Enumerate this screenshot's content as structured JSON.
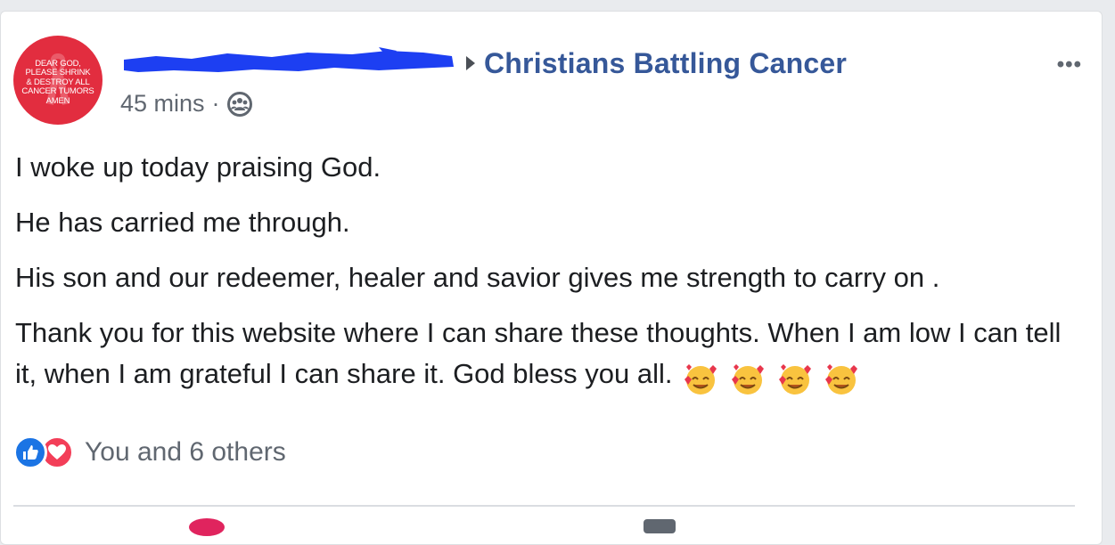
{
  "post": {
    "avatar_text": "DEAR GOD,\nPLEASE SHRINK\n& DESTROY ALL\nCANCER TUMORS\nAMEN",
    "group_name": "Christians Battling Cancer",
    "timestamp": "45 mins",
    "separator": "·",
    "audience_icon": "group-members-icon",
    "more_label": "•••",
    "body": {
      "line1": "I woke up today praising God.",
      "line2": "He has carried me through.",
      "line3": "His son and our redeemer, healer and savior gives me strength to carry on .",
      "line4": "Thank you for this website where I can share these thoughts. When I am low I can tell it, when I am grateful I can share it. God bless you all."
    },
    "emoji_name": "smiling-face-with-hearts",
    "reactions": {
      "text": "You and 6 others",
      "like_color": "#1b74e4",
      "love_color": "#f33e58"
    }
  },
  "colors": {
    "link": "#365899",
    "secondary": "#606770",
    "redaction": "#1d3ff2",
    "avatar_bg": "#e22d3f"
  }
}
